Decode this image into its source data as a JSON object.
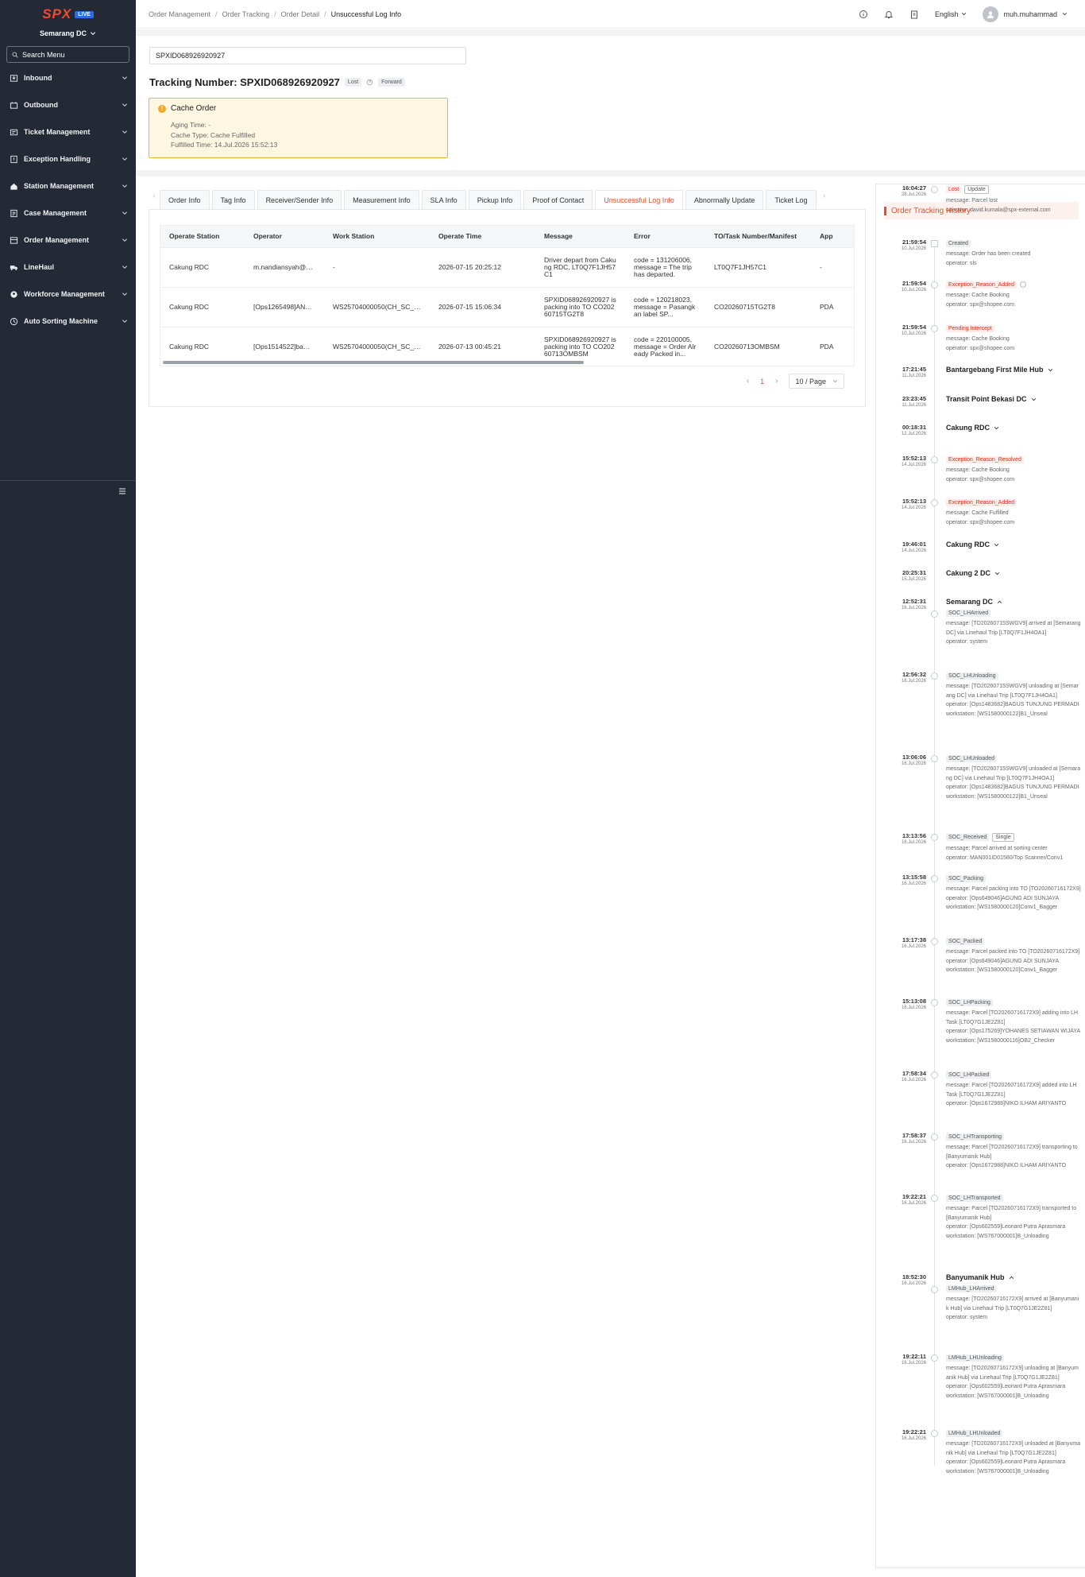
{
  "sidebar": {
    "logo": "SPX",
    "live_badge": "LIVE",
    "station": "Semarang DC",
    "search_placeholder": "Search Menu",
    "items": [
      {
        "label": "Inbound",
        "icon": "inbound-icon"
      },
      {
        "label": "Outbound",
        "icon": "outbound-icon"
      },
      {
        "label": "Ticket Management",
        "icon": "ticket-icon"
      },
      {
        "label": "Exception Handling",
        "icon": "exception-icon"
      },
      {
        "label": "Station Management",
        "icon": "station-icon"
      },
      {
        "label": "Case Management",
        "icon": "case-icon"
      },
      {
        "label": "Order Management",
        "icon": "order-icon"
      },
      {
        "label": "LineHaul",
        "icon": "truck-icon"
      },
      {
        "label": "Workforce Management",
        "icon": "workforce-icon"
      },
      {
        "label": "Auto Sorting Machine",
        "icon": "sorting-icon"
      }
    ]
  },
  "breadcrumb": [
    "Order Management",
    "Order Tracking",
    "Order Detail",
    "Unsuccessful Log Info"
  ],
  "header": {
    "language": "English",
    "username": "muh.muhammad"
  },
  "search": {
    "value": "SPXID068926920927"
  },
  "tracking": {
    "title": "Tracking Number: SPXID068926920927",
    "status_tag": "Lost",
    "direction_tag": "Forward"
  },
  "cache": {
    "title": "Cache Order",
    "aging": "Aging Time: -",
    "type": "Cache Type: Cache Fulfilled",
    "fulfilled": "Fulfilled Time: 14.Jul.2026 15:52:13"
  },
  "tabs": [
    "Order Info",
    "Tag Info",
    "Receiver/Sender Info",
    "Measurement Info",
    "SLA Info",
    "Pickup Info",
    "Proof of Contact",
    "Unsuccessful Log Info",
    "Abnormally Update",
    "Ticket Log"
  ],
  "active_tab": "Unsuccessful Log Info",
  "table": {
    "headers": [
      "Operate Station",
      "Operator",
      "Work Station",
      "Operate Time",
      "Message",
      "Error",
      "TO/Task Number/Manifest",
      "App"
    ],
    "rows": [
      [
        "Cakung RDC",
        "m.nandiansyah@sp...",
        "-",
        "2026-07-15 20:25:12",
        "Driver depart from Cakung RDC, LT0Q7F1JH57C1",
        "code = 131206006, message = The trip has departed.",
        "LT0Q7F1JH57C1",
        "-"
      ],
      [
        "Cakung RDC",
        "[Ops1265498]ANDI...",
        "WS25704000050(CH_SC_S...",
        "2026-07-15 15:06:34",
        "SPXID068926920927 is packing into TO CO20260715TG2T8",
        "code = 120218023, message = Pasangkan label SP...",
        "CO20260715TG2T8",
        "PDA"
      ],
      [
        "Cakung RDC",
        "[Ops1514522]bamb...",
        "WS25704000050(CH_SC_S...",
        "2026-07-13 00:45:21",
        "SPXID068926920927 is packing into TO CO20260713OMBSM",
        "code = 220100005, message = Order Already Packed in...",
        "CO20260713OMBSM",
        "PDA"
      ]
    ]
  },
  "pagination": {
    "current": "1",
    "page_size": "10 / Page"
  },
  "history": {
    "title": "Order Tracking History",
    "events": [
      {
        "time": "21:59:54",
        "date": "10.Jul.2026",
        "tag": "Created",
        "tag_style": "gray",
        "msg": [
          "message: Order has been created",
          "operator: sls"
        ]
      },
      {
        "time": "21:59:54",
        "date": "10.Jul.2026",
        "tag": "Exception_Reason_Added",
        "tag_style": "red",
        "help": true,
        "msg": [
          "message: Cache Booking",
          "operator: spx@shopee.com"
        ]
      },
      {
        "time": "21:59:54",
        "date": "10.Jul.2026",
        "tag": "Pending Intercept",
        "tag_style": "red",
        "msg": [
          "message: Cache Booking",
          "operator: spx@shopee.com"
        ]
      },
      {
        "time": "17:21:45",
        "date": "11.Jul.2026",
        "station": "Bantargebang First Mile Hub",
        "collapsed": true
      },
      {
        "time": "23:23:45",
        "date": "11.Jul.2026",
        "station": "Transit Point Bekasi DC",
        "collapsed": true
      },
      {
        "time": "00:18:31",
        "date": "12.Jul.2026",
        "station": "Cakung RDC",
        "collapsed": true
      },
      {
        "time": "15:52:13",
        "date": "14.Jul.2026",
        "tag": "Exception_Reason_Resolved",
        "tag_style": "red",
        "msg": [
          "message: Cache Booking",
          "operator: spx@shopee.com"
        ]
      },
      {
        "time": "15:52:13",
        "date": "14.Jul.2026",
        "tag": "Exception_Reason_Added",
        "tag_style": "red",
        "msg": [
          "message: Cache Fulfilled",
          "operator: spx@shopee.com"
        ]
      },
      {
        "time": "19:46:01",
        "date": "14.Jul.2026",
        "station": "Cakung RDC",
        "collapsed": true
      },
      {
        "time": "20:25:31",
        "date": "15.Jul.2026",
        "station": "Cakung 2 DC",
        "collapsed": true
      },
      {
        "time": "12:52:31",
        "date": "16.Jul.2026",
        "station": "Semarang DC",
        "collapsed": false,
        "tag": "SOC_LHArrived",
        "tag_style": "gray",
        "msg": [
          "message: [TO20260715SWGV9] arrived at [Semarang DC] via Linehaul Trip [LT0Q7F1JH4OA1]",
          "operator: system"
        ]
      },
      {
        "time": "12:56:32",
        "date": "16.Jul.2026",
        "tag": "SOC_LHUnloading",
        "tag_style": "gray",
        "msg": [
          "message: [TO20260715SWGV9] unloading at [Semarang DC] via Linehaul Trip [LT0Q7F1JH4OA1]",
          "operator: [Ops1483682]BAGUS TUNJUNG PERMADI",
          "workstation: [WS1580000122]B1_Unseal"
        ]
      },
      {
        "time": "13:06:06",
        "date": "16.Jul.2026",
        "tag": "SOC_LHUnloaded",
        "tag_style": "gray",
        "msg": [
          "message: [TO20260715SWGV9] unloaded at [Semarang DC] via Linehaul Trip [LT0Q7F1JH4OA1]",
          "operator: [Ops1483682]BAGUS TUNJUNG PERMADI",
          "workstation: [WS1580000122]B1_Unseal"
        ]
      },
      {
        "time": "13:13:56",
        "date": "16.Jul.2026",
        "tag": "SOC_Received",
        "tag_style": "gray",
        "tag2": "Single",
        "msg": [
          "message: Parcel arrived at sorting center",
          "operator: MAN001ID01580/Top Scanner/Conv1"
        ]
      },
      {
        "time": "13:15:58",
        "date": "16.Jul.2026",
        "tag": "SOC_Packing",
        "tag_style": "gray",
        "msg": [
          "message: Parcel packing into TO [TO20260716172X9]",
          "operator: [Ops649046]AGUNG ADI SUNJAYA",
          "workstation: [WS1580000120]Conv1_Bagger"
        ]
      },
      {
        "time": "13:17:38",
        "date": "16.Jul.2026",
        "tag": "SOC_Packed",
        "tag_style": "gray",
        "msg": [
          "message: Parcel packed into TO [TO20260716172X9]",
          "operator: [Ops649046]AGUNG ADI SUNJAYA",
          "workstation: [WS1580000120]Conv1_Bagger"
        ]
      },
      {
        "time": "15:13:08",
        "date": "16.Jul.2026",
        "tag": "SOC_LHPacking",
        "tag_style": "gray",
        "msg": [
          "message: Parcel [TO20260716172X9] adding into LH Task [LT0Q7G1JE2Z81]",
          "operator: [Ops175269]YOHANES SETIAWAN WIJAYA",
          "workstation: [WS1580000116]OB2_Checker"
        ]
      },
      {
        "time": "17:58:34",
        "date": "16.Jul.2026",
        "tag": "SOC_LHPacked",
        "tag_style": "gray",
        "msg": [
          "message: Parcel [TO20260716172X9] added into LH Task [LT0Q7G1JE2Z81]",
          "operator: [Ops1672988]NIKO ILHAM ARIYANTO"
        ]
      },
      {
        "time": "17:58:37",
        "date": "16.Jul.2026",
        "tag": "SOC_LHTransporting",
        "tag_style": "gray",
        "msg": [
          "message: Parcel [TO20260716172X9] transporting to [Banyumanik Hub]",
          "operator: [Ops1672988]NIKO ILHAM ARIYANTO"
        ]
      },
      {
        "time": "19:22:21",
        "date": "16.Jul.2026",
        "tag": "SOC_LHTransported",
        "tag_style": "gray",
        "msg": [
          "message: Parcel [TO20260716172X9] transported to [Banyumanik Hub]",
          "operator: [Ops602559]Leonard Putra Aprasmara",
          "workstation: [WS767000001]B_Unloading"
        ]
      },
      {
        "time": "18:52:30",
        "date": "16.Jul.2026",
        "station": "Banyumanik Hub",
        "collapsed": false,
        "tag": "LMHub_LHArrived",
        "tag_style": "gray",
        "msg": [
          "message: [TO20260716172X9] arrived at [Banyumanik Hub] via Linehaul Trip [LT0Q7G1JE2Z81]",
          "operator: system"
        ]
      },
      {
        "time": "19:22:11",
        "date": "16.Jul.2026",
        "tag": "LMHub_LHUnloading",
        "tag_style": "gray",
        "msg": [
          "message: [TO20260716172X9] unloading at [Banyumanik Hub] via Linehaul Trip [LT0Q7G1JE2Z81]",
          "operator: [Ops602559]Leonard Putra Aprasmara",
          "workstation: [WS767000001]B_Unloading"
        ]
      },
      {
        "time": "19:22:21",
        "date": "16.Jul.2026",
        "tag": "LMHub_LHUnloaded",
        "tag_style": "gray",
        "msg": [
          "message: [TO20260716172X9] unloaded at [Banyumanik Hub] via Linehaul Trip [LT0Q7G1JE2Z81]",
          "operator: [Ops602559]Leonard Putra Aprasmara",
          "workstation: [WS767000001]B_Unloading"
        ]
      },
      {
        "time": "16:04:27",
        "date": "28.Jul.2026",
        "tag": "Lost",
        "tag_style": "red",
        "tag2": "Update",
        "msg": [
          "message: Parcel lost",
          "operator: david.kumala@spx-external.com"
        ]
      }
    ]
  },
  "colors": {
    "brand": "#ee4d2d",
    "sidebar_bg": "#232a36",
    "warning_border": "#f5b335",
    "warning_bg": "#fdf6e1"
  }
}
